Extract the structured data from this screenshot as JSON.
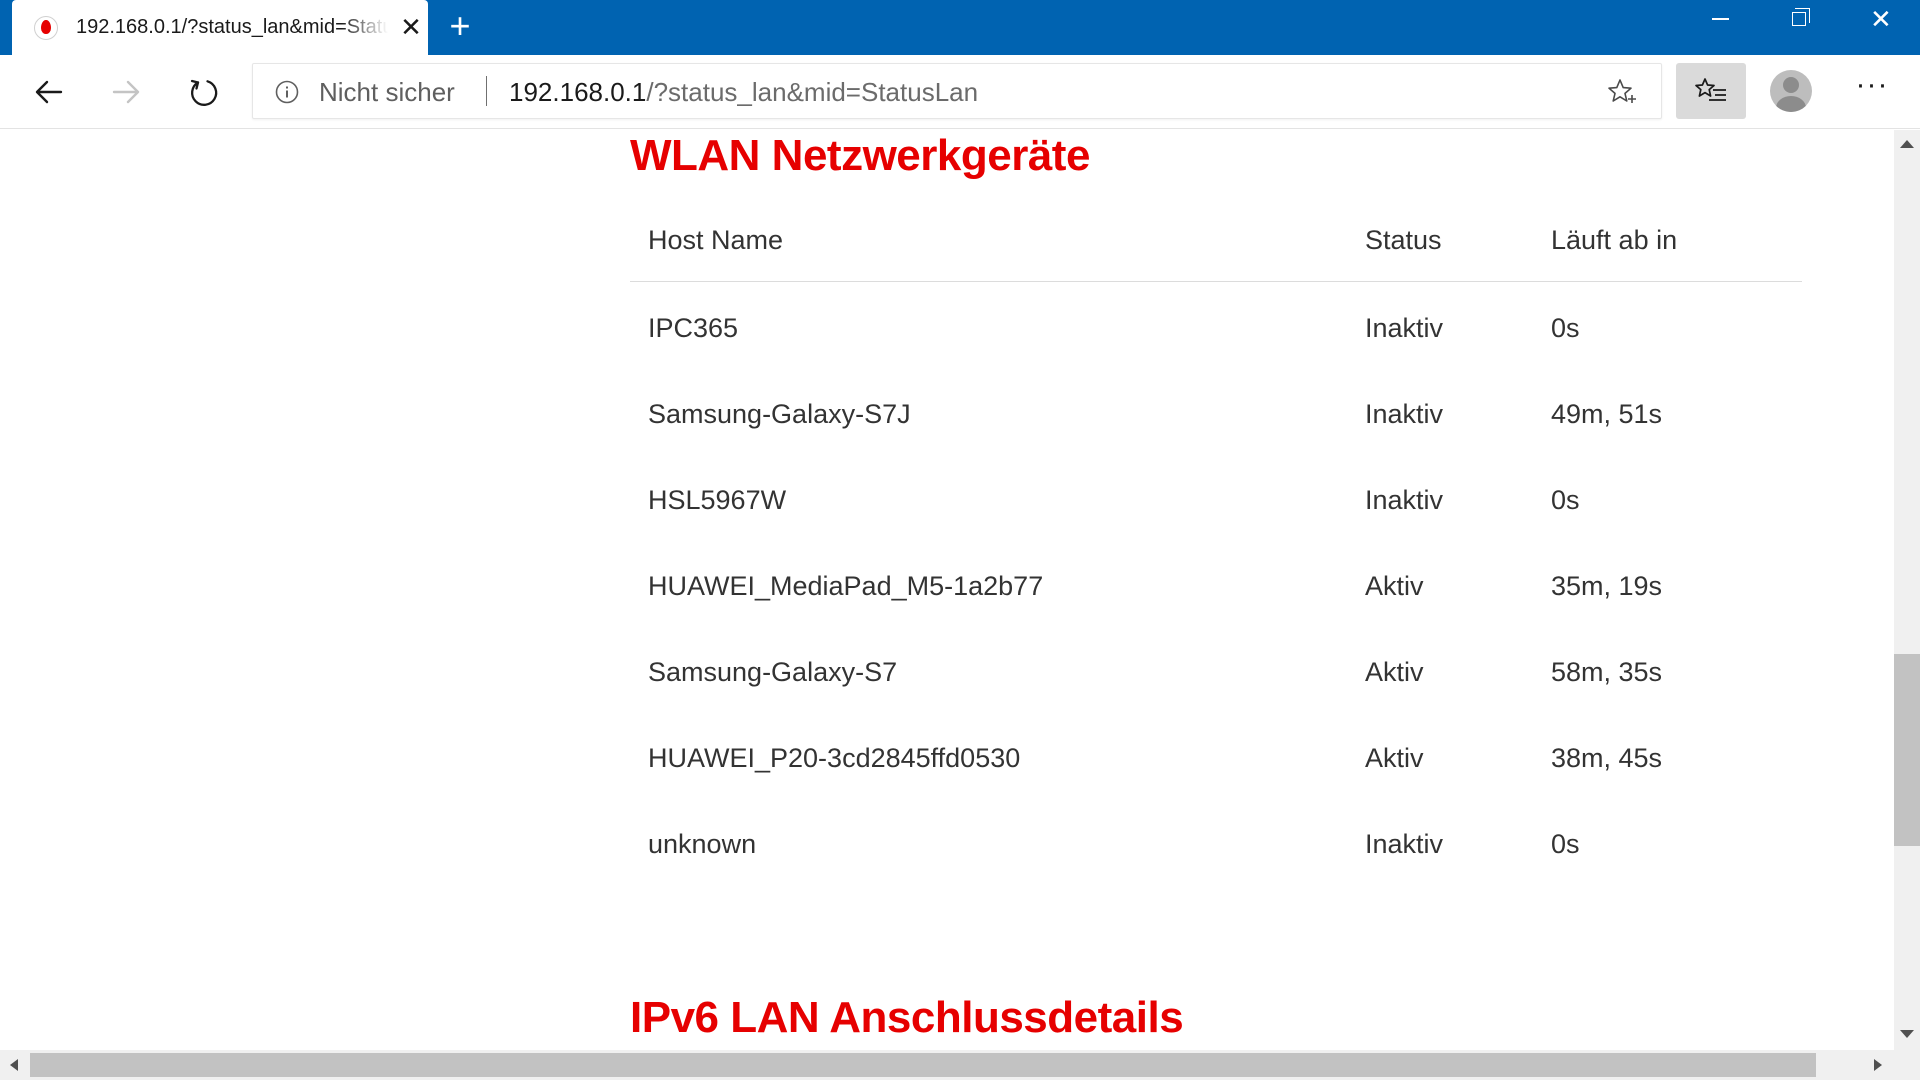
{
  "tab": {
    "title": "192.168.0.1/?status_lan&mid=StatusLan",
    "favicon": "vodafone-icon",
    "close_glyph": "✕"
  },
  "window": {
    "new_tab_glyph": "+",
    "close_glyph": "✕"
  },
  "toolbar": {
    "security_text": "Nicht sicher",
    "url_host": "192.168.0.1",
    "url_rest": "/?status_lan&mid=StatusLan",
    "more_glyph": "···"
  },
  "page": {
    "wlan_title": "WLAN Netzwerkgeräte",
    "ipv6_title": "IPv6 LAN Anschlussdetails",
    "accent_color": "#e60000"
  },
  "wlan_table": {
    "headers": {
      "host": "Host Name",
      "status": "Status",
      "expires": "Läuft ab in"
    },
    "rows": [
      {
        "host": "IPC365",
        "status": "Inaktiv",
        "expires": "0s"
      },
      {
        "host": "Samsung-Galaxy-S7J",
        "status": "Inaktiv",
        "expires": "49m, 51s"
      },
      {
        "host": "HSL5967W",
        "status": "Inaktiv",
        "expires": "0s"
      },
      {
        "host": "HUAWEI_MediaPad_M5-1a2b77",
        "status": "Aktiv",
        "expires": "35m, 19s"
      },
      {
        "host": "Samsung-Galaxy-S7",
        "status": "Aktiv",
        "expires": "58m, 35s"
      },
      {
        "host": "HUAWEI_P20-3cd2845ffd0530",
        "status": "Aktiv",
        "expires": "38m, 45s"
      },
      {
        "host": "unknown",
        "status": "Inaktiv",
        "expires": "0s"
      }
    ]
  }
}
